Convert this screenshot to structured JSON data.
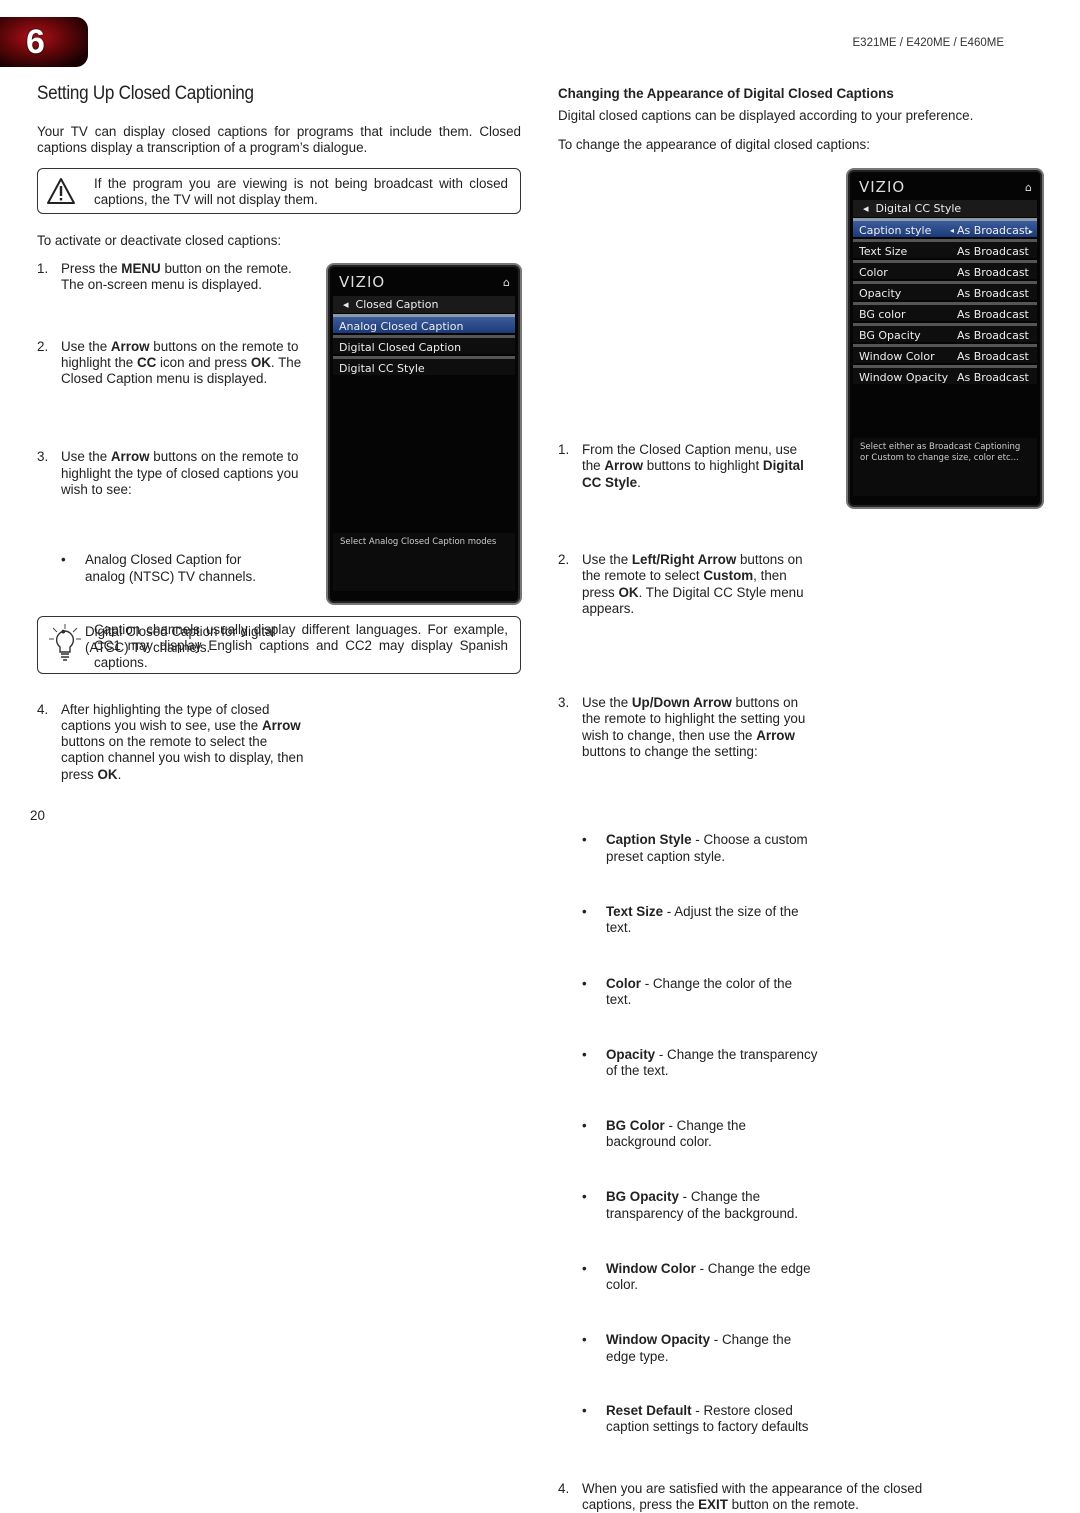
{
  "header": {
    "chapter": "6",
    "model": "E321ME / E420ME / E460ME"
  },
  "left": {
    "title": "Setting Up Closed Captioning",
    "intro": "Your TV can display closed captions for programs that include them. Closed captions display a transcription of a program’s dialogue.",
    "warning": "If the program you are viewing is not being broadcast with closed captions, the TV will not display them.",
    "activate": "To activate or deactivate closed captions:",
    "steps": [
      [
        {
          "t": "Press the "
        },
        {
          "t": "MENU",
          "b": 1
        },
        {
          "t": " button on the remote. The on-screen menu is displayed."
        }
      ],
      [
        {
          "t": "Use the "
        },
        {
          "t": "Arrow",
          "b": 1
        },
        {
          "t": " buttons on the remote to highlight the "
        },
        {
          "t": "CC",
          "b": 1
        },
        {
          "t": " icon and press "
        },
        {
          "t": "OK",
          "b": 1
        },
        {
          "t": ". The Closed Caption menu is displayed."
        }
      ],
      [
        {
          "t": "Use the "
        },
        {
          "t": "Arrow",
          "b": 1
        },
        {
          "t": " buttons on the remote to highlight the type of closed captions you wish to see:"
        }
      ],
      [
        {
          "t": "After highlighting the type of closed captions you wish to see, use the "
        },
        {
          "t": "Arrow",
          "b": 1
        },
        {
          "t": " buttons on the remote to select the caption channel you wish to display, then press "
        },
        {
          "t": "OK",
          "b": 1
        },
        {
          "t": "."
        }
      ]
    ],
    "bullets": [
      "Analog Closed Caption for analog (NTSC) TV channels.",
      "Digital Closed Caption for digital (ATSC) TV channels."
    ],
    "tip": "Caption channels usually display different languages. For example, CC1 may display English captions and CC2 may display Spanish captions."
  },
  "tv1": {
    "logo": "VIZIO",
    "header": "Closed Caption",
    "items": [
      "Analog Closed Caption",
      "Digital Closed Caption",
      "Digital CC Style"
    ],
    "help": "Select Analog Closed Caption modes"
  },
  "tv2": {
    "logo": "VIZIO",
    "header": "Digital CC Style",
    "items": [
      [
        "Caption style",
        "As Broadcast"
      ],
      [
        "Text Size",
        "As Broadcast"
      ],
      [
        "Color",
        "As Broadcast"
      ],
      [
        "Opacity",
        "As Broadcast"
      ],
      [
        "BG color",
        "As Broadcast"
      ],
      [
        "BG Opacity",
        "As Broadcast"
      ],
      [
        "Window Color",
        "As Broadcast"
      ],
      [
        "Window Opacity",
        "As Broadcast"
      ]
    ],
    "help": "Select either as Broadcast Captioning or Custom to change size, color etc..."
  },
  "right": {
    "heading": "Changing the Appearance of Digital Closed Captions",
    "p1": "Digital closed captions can be displayed according to your preference.",
    "p2": "To change the appearance of digital closed captions:",
    "steps": [
      [
        {
          "t": "From the Closed Caption menu, use the "
        },
        {
          "t": "Arrow",
          "b": 1
        },
        {
          "t": " buttons to highlight "
        },
        {
          "t": "Digital CC Style",
          "b": 1
        },
        {
          "t": "."
        }
      ],
      [
        {
          "t": "Use the "
        },
        {
          "t": "Left/Right Arrow",
          "b": 1
        },
        {
          "t": " buttons on the remote to select "
        },
        {
          "t": "Custom",
          "b": 1
        },
        {
          "t": ", then press "
        },
        {
          "t": "OK",
          "b": 1
        },
        {
          "t": ". The Digital CC Style menu appears."
        }
      ],
      [
        {
          "t": "Use the "
        },
        {
          "t": "Up/Down Arrow",
          "b": 1
        },
        {
          "t": " buttons on the remote to highlight the setting you wish to change, then use the "
        },
        {
          "t": "Arrow",
          "b": 1
        },
        {
          "t": " buttons to change the setting:"
        }
      ],
      [
        {
          "t": "When you are satisfied with the appearance of the closed captions, press the "
        },
        {
          "t": "EXIT",
          "b": 1
        },
        {
          "t": " button on the remote."
        }
      ]
    ],
    "bullets": [
      [
        {
          "t": "Caption Style",
          "b": 1
        },
        {
          "t": " - Choose a custom preset caption style."
        }
      ],
      [
        {
          "t": "Text Size",
          "b": 1
        },
        {
          "t": " - Adjust the size of the text."
        }
      ],
      [
        {
          "t": "Color",
          "b": 1
        },
        {
          "t": " - Change the color of the text."
        }
      ],
      [
        {
          "t": "Opacity",
          "b": 1
        },
        {
          "t": " - Change the transparency of the text."
        }
      ],
      [
        {
          "t": "BG Color",
          "b": 1
        },
        {
          "t": " - Change the background color."
        }
      ],
      [
        {
          "t": "BG Opacity",
          "b": 1
        },
        {
          "t": " - Change the transparency of the background."
        }
      ],
      [
        {
          "t": "Window Color",
          "b": 1
        },
        {
          "t": " - Change the edge color."
        }
      ],
      [
        {
          "t": "Window Opacity",
          "b": 1
        },
        {
          "t": " - Change the edge type."
        }
      ],
      [
        {
          "t": "Reset Default",
          "b": 1
        },
        {
          "t": " - Restore closed caption settings to factory defaults"
        }
      ]
    ]
  },
  "footer": {
    "page": "20"
  }
}
